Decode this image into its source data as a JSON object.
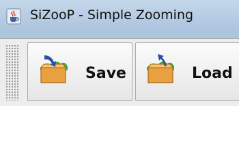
{
  "window": {
    "title": "SiZooP - Simple Zooming",
    "app_icon": "java-cup-icon"
  },
  "toolbar": {
    "buttons": [
      {
        "label": "Save",
        "icon": "save-box-icon"
      },
      {
        "label": "Load",
        "icon": "load-box-icon"
      }
    ]
  },
  "colors": {
    "titlebar": "#b6cce3",
    "toolbar_bg": "#ededed",
    "box_orange": "#e8a040",
    "box_green": "#4aa83a",
    "arrow_blue": "#2a4fa8"
  }
}
